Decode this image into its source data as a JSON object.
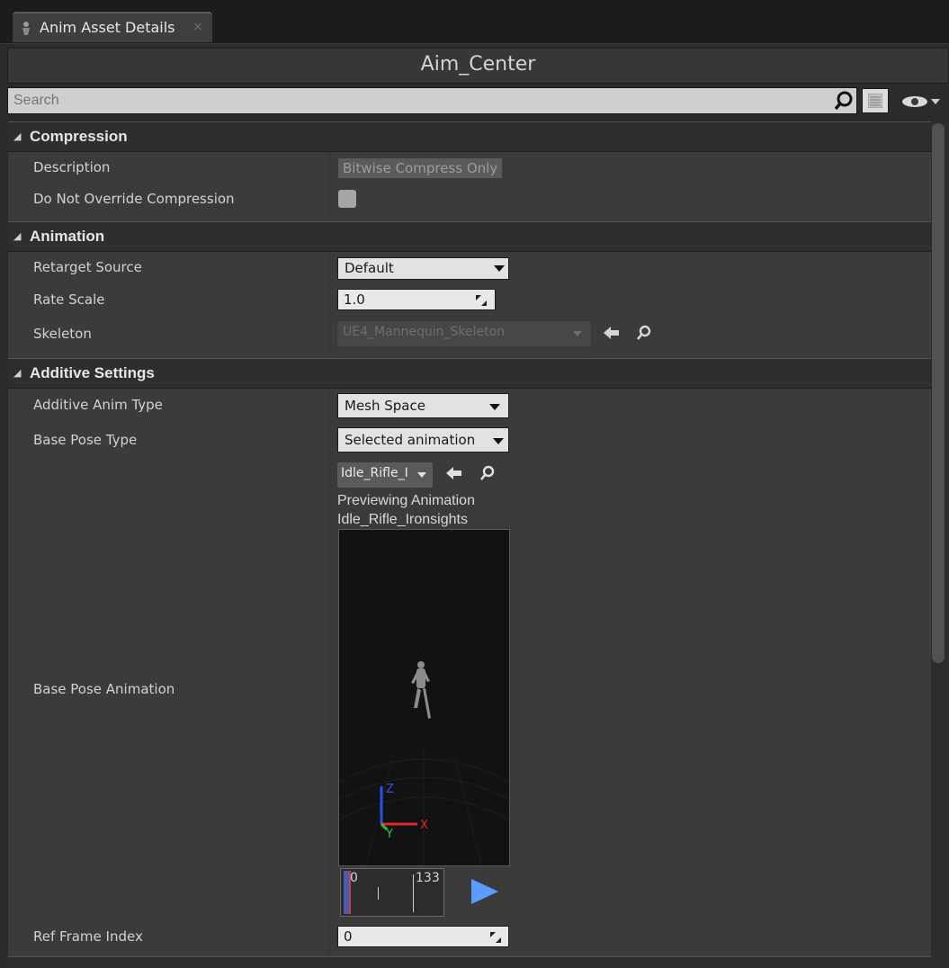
{
  "tab": {
    "label": "Anim Asset Details",
    "close": "×"
  },
  "asset_title": "Aim_Center",
  "search": {
    "placeholder": "Search"
  },
  "sections": {
    "compression": {
      "title": "Compression",
      "description_label": "Description",
      "description_value": "Bitwise Compress Only",
      "override_label": "Do Not Override Compression",
      "override_checked": false
    },
    "animation": {
      "title": "Animation",
      "retarget_label": "Retarget Source",
      "retarget_value": "Default",
      "rate_label": "Rate Scale",
      "rate_value": "1.0",
      "skeleton_label": "Skeleton",
      "skeleton_value": "UE4_Mannequin_Skeleton"
    },
    "additive": {
      "title": "Additive Settings",
      "anim_type_label": "Additive Anim Type",
      "anim_type_value": "Mesh Space",
      "pose_type_label": "Base Pose Type",
      "pose_type_value": "Selected animation",
      "base_anim_label": "Base Pose Animation",
      "base_anim_value": "Idle_Rifle_I",
      "preview_line1": "Previewing Animation",
      "preview_line2": "Idle_Rifle_Ironsights",
      "timeline_start": "0",
      "timeline_end": "133",
      "ref_frame_label": "Ref Frame Index",
      "ref_frame_value": "0"
    }
  },
  "axes": {
    "x": "X",
    "y": "Y",
    "z": "Z"
  },
  "colors": {
    "accent_blue": "#4d90ff",
    "axis_red": "#e0262b",
    "axis_green": "#27c43b",
    "axis_blue": "#2b52e8"
  },
  "icons": [
    "gear-icon",
    "search-icon",
    "grid-icon",
    "eye-icon",
    "arrow-left-icon",
    "play-icon"
  ]
}
